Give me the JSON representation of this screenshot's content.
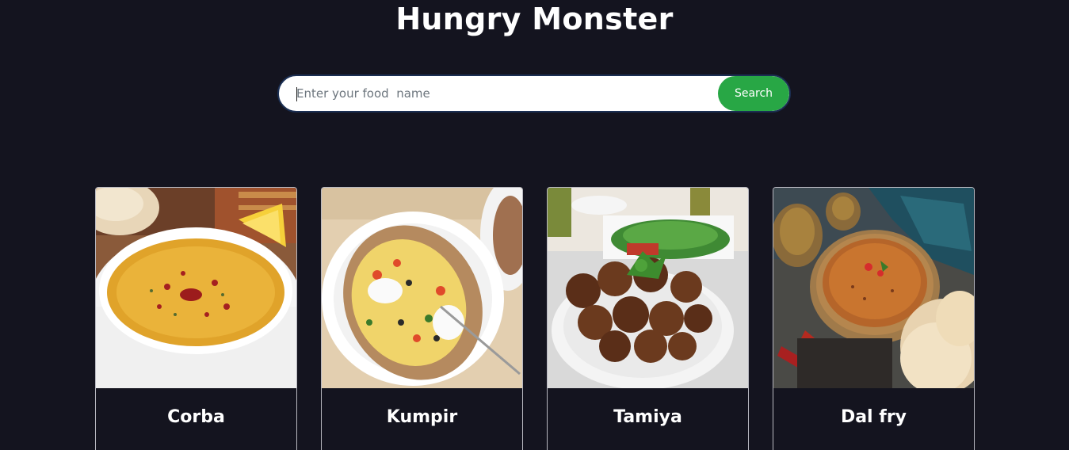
{
  "header": {
    "title": "Hungry Monster"
  },
  "search": {
    "placeholder": "Enter your food  name",
    "value": "",
    "button_label": "Search"
  },
  "colors": {
    "background": "#14141f",
    "button": "#28a745",
    "text": "#ffffff"
  },
  "meals": [
    {
      "name": "Corba",
      "image": "lentil-soup-photo"
    },
    {
      "name": "Kumpir",
      "image": "stuffed-baked-potato-photo"
    },
    {
      "name": "Tamiya",
      "image": "falafel-plate-photo"
    },
    {
      "name": "Dal fry",
      "image": "dal-curry-bowl-photo"
    }
  ]
}
